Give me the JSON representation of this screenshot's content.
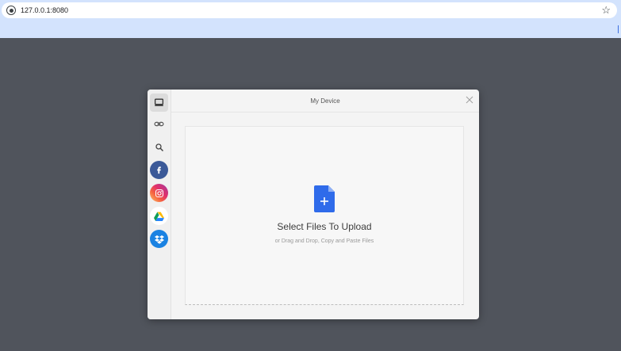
{
  "browser": {
    "url": "127.0.0.1:8080"
  },
  "modal": {
    "title": "My Device",
    "sources": [
      {
        "name": "my-device",
        "icon": "monitor-icon"
      },
      {
        "name": "link",
        "icon": "link-icon"
      },
      {
        "name": "web-search",
        "icon": "search-icon"
      },
      {
        "name": "facebook",
        "icon": "facebook-icon",
        "color": "#3b5998"
      },
      {
        "name": "instagram",
        "icon": "instagram-icon",
        "color": "#e1306c"
      },
      {
        "name": "google-drive",
        "icon": "google-drive-icon",
        "color": "#ffffff"
      },
      {
        "name": "dropbox",
        "icon": "dropbox-icon",
        "color": "#1a82e2"
      }
    ],
    "dropzone": {
      "title": "Select Files To Upload",
      "subtitle": "or Drag and Drop, Copy and Paste Files",
      "accent": "#2f6bea"
    }
  }
}
